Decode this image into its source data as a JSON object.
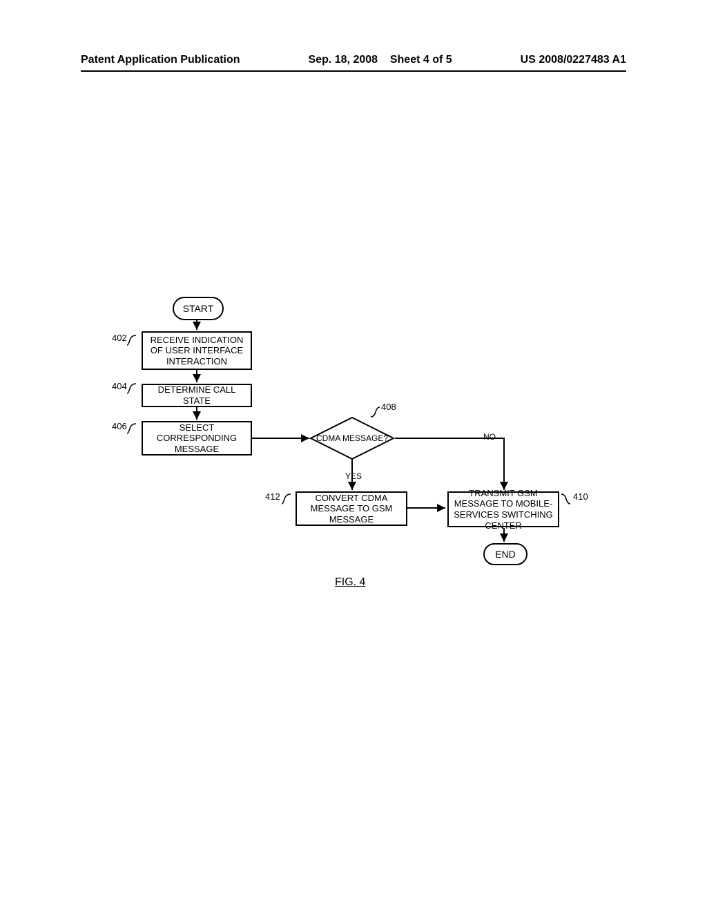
{
  "header": {
    "publication_label": "Patent Application Publication",
    "date": "Sep. 18, 2008",
    "sheet": "Sheet 4 of 5",
    "pubno": "US 2008/0227483 A1"
  },
  "flowchart": {
    "start": "START",
    "end": "END",
    "steps": {
      "402": "RECEIVE INDICATION OF USER INTERFACE INTERACTION",
      "404": "DETERMINE CALL STATE",
      "406": "SELECT CORRESPONDING MESSAGE",
      "408": "CDMA MESSAGE?",
      "410": "TRANSMIT GSM MESSAGE TO MOBILE-SERVICES SWITCHING CENTER",
      "412": "CONVERT CDMA MESSAGE TO GSM MESSAGE"
    },
    "refs": {
      "r402": "402",
      "r404": "404",
      "r406": "406",
      "r408": "408",
      "r410": "410",
      "r412": "412"
    },
    "edges": {
      "yes": "YES",
      "no": "NO"
    }
  },
  "figure_label": "FIG. 4"
}
